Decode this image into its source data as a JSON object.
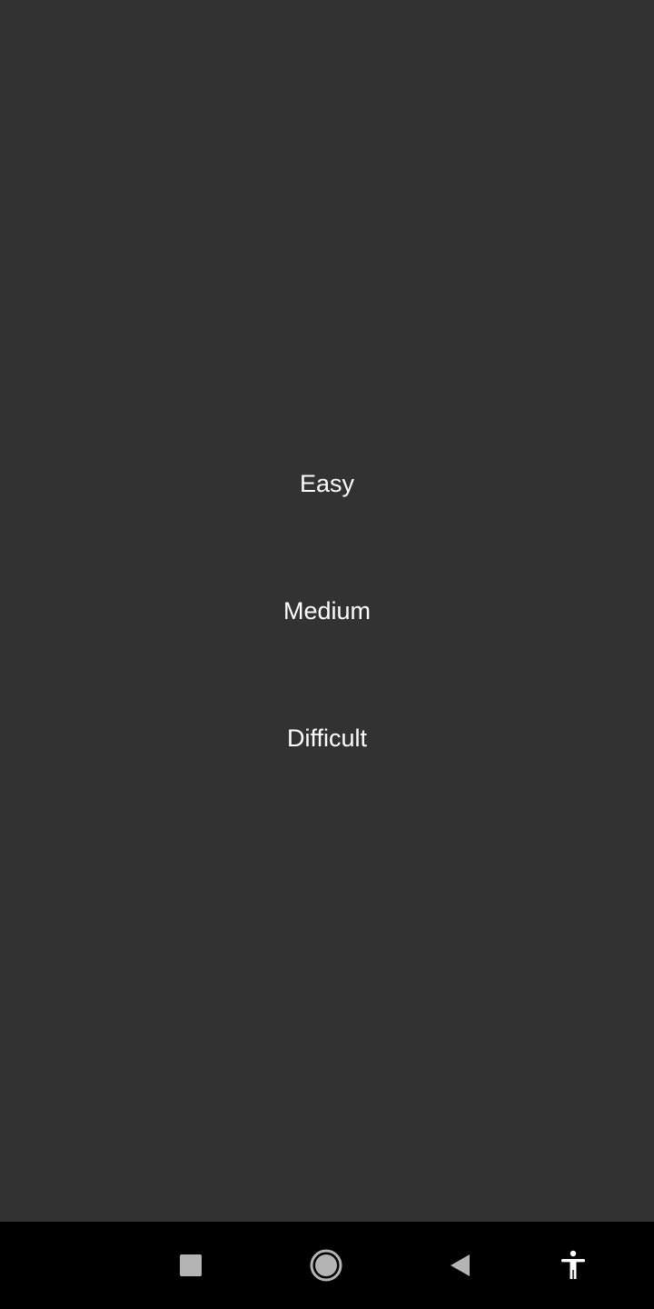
{
  "difficulty_menu": {
    "options": [
      {
        "label": "Easy"
      },
      {
        "label": "Medium"
      },
      {
        "label": "Difficult"
      }
    ]
  },
  "navigation_bar": {
    "buttons": [
      {
        "icon": "square-recents-icon"
      },
      {
        "icon": "circle-home-icon"
      },
      {
        "icon": "triangle-back-icon"
      },
      {
        "icon": "accessibility-person-icon"
      }
    ]
  },
  "colors": {
    "background": "#323232",
    "nav_background": "#000000",
    "text": "#ffffff",
    "nav_icon": "#b4b4b4"
  }
}
